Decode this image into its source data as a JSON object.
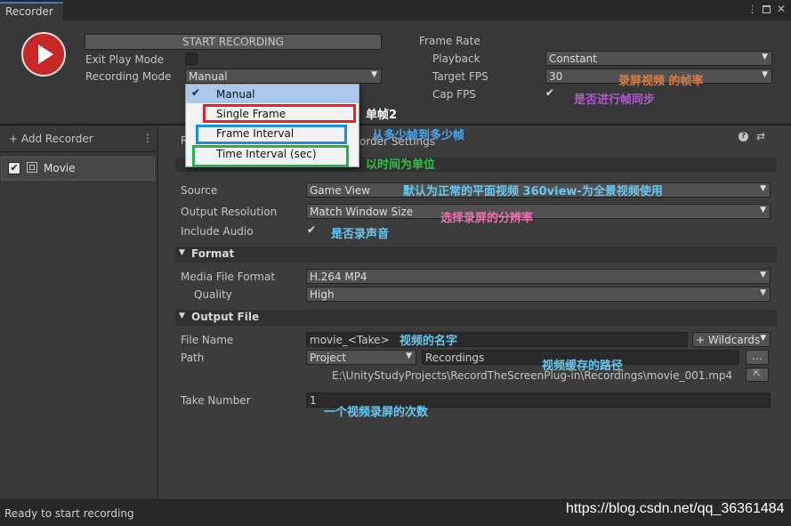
{
  "window": {
    "tab_title": "Recorder",
    "menu_icon": "kebab-icon",
    "maximize_icon": "maximize-icon",
    "close_icon": "close-icon"
  },
  "controls": {
    "start_button": "START RECORDING",
    "exit_play_mode_label": "Exit Play Mode",
    "exit_play_mode_checked": false,
    "recording_mode_label": "Recording Mode",
    "recording_mode_value": "Manual"
  },
  "recording_mode_menu": {
    "options": [
      "Manual",
      "Single Frame",
      "Frame Interval",
      "Time Interval (sec)"
    ],
    "selected": "Manual"
  },
  "frame_rate": {
    "title": "Frame Rate",
    "playback_label": "Playback",
    "playback_value": "Constant",
    "target_fps_label": "Target FPS",
    "target_fps_value": "30",
    "cap_fps_label": "Cap FPS",
    "cap_fps_checked": true
  },
  "sidebar": {
    "add_recorder": "+ Add Recorder",
    "items": [
      {
        "label": "Movie",
        "enabled": true
      }
    ]
  },
  "recorder_panel": {
    "header_left": "R",
    "header_right": "order Settings",
    "input_section": {
      "source_label": "Source",
      "source_value": "Game View",
      "output_resolution_label": "Output Resolution",
      "output_resolution_value": "Match Window Size",
      "include_audio_label": "Include Audio",
      "include_audio_checked": true
    },
    "format_section": {
      "title": "Format",
      "media_format_label": "Media File Format",
      "media_format_value": "H.264 MP4",
      "quality_label": "Quality",
      "quality_value": "High"
    },
    "output_section": {
      "title": "Output File",
      "file_name_label": "File Name",
      "file_name_value": "movie_<Take>",
      "wildcards_button": "+ Wildcards",
      "path_label": "Path",
      "path_root": "Project",
      "path_folder": "Recordings",
      "browse_button": "...",
      "full_path": "E:\\UnityStudyProjects\\RecordTheScreenPlug-in\\Recordings\\movie_001.mp4",
      "take_number_label": "Take Number",
      "take_number_value": "1"
    }
  },
  "status_bar": {
    "text": "Ready to start recording"
  },
  "watermark": "https://blog.csdn.net/qq_36361484",
  "annotations": {
    "single_frame": "单帧2",
    "frame_interval": "从多少帧到多少帧",
    "time_interval": "以时间为单位",
    "target_fps": "录屏视频 的帧率",
    "cap_fps": "是否进行帧同步",
    "source": "默认为正常的平面视频   360view-为全景视频使用",
    "resolution": "选择录屏的分辨率",
    "audio": "是否录声音",
    "file_name": "视频的名字",
    "path": "视频缓存的路径",
    "take_number": "一个视频录屏的次数"
  },
  "colors": {
    "red_box": "#e8202a",
    "blue_box": "#1c8fdc",
    "green_box": "#22b14c",
    "anno_white": "#ffffff",
    "anno_blue": "#4aa8f0",
    "anno_green": "#2cc440",
    "anno_orange": "#e07a3a",
    "anno_purple": "#b05ad0",
    "anno_pink": "#f070b0",
    "anno_cyan": "#66c8f0"
  }
}
